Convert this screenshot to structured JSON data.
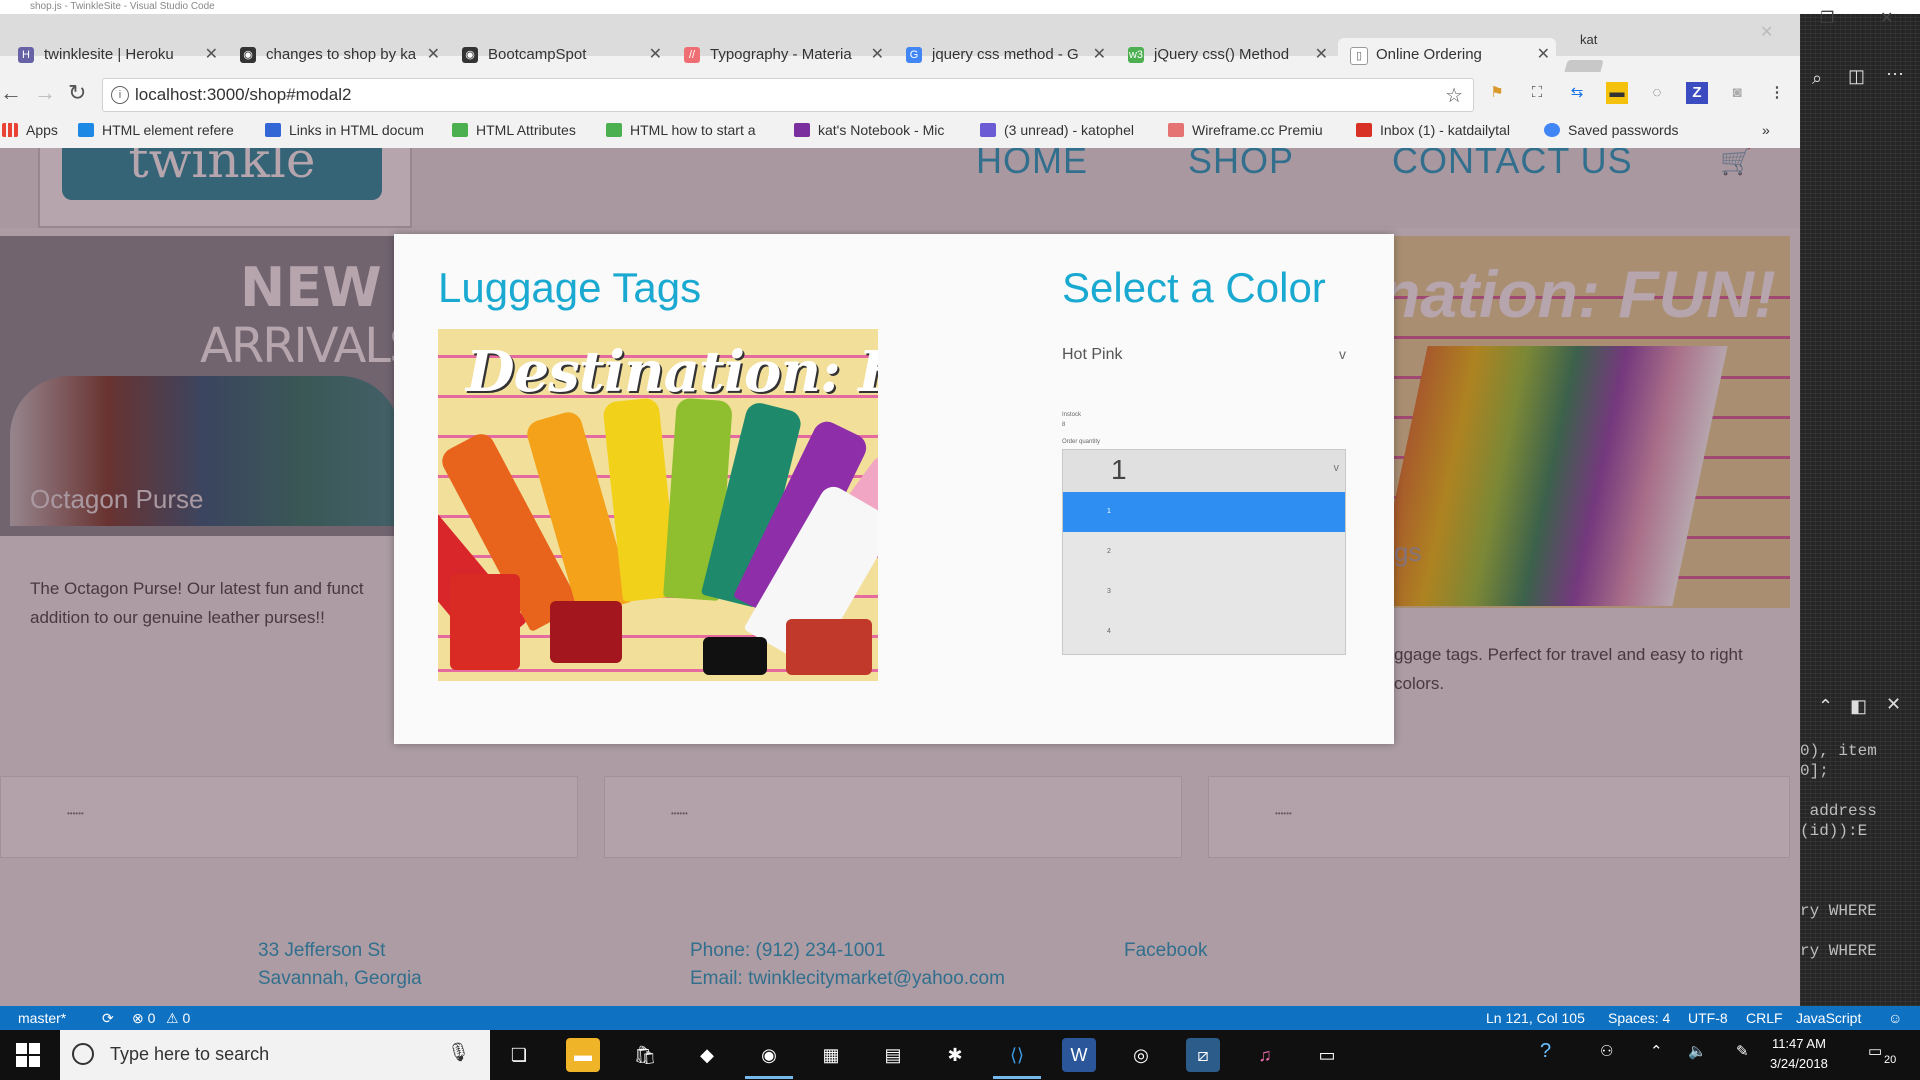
{
  "vscode": {
    "title": "shop.js - TwinkleSite - Visual Studio Code",
    "code_lines": [
      {
        "text": "0), item"
      },
      {
        "text": "0];"
      },
      {
        "text": " address"
      },
      {
        "text": "(id)):E"
      },
      {
        "text": "ry WHERE"
      },
      {
        "text": "ry WHERE"
      }
    ],
    "statusbar": {
      "branch": "master*",
      "sync": "⟳",
      "errors": "⊗ 0",
      "warnings": "⚠ 0",
      "position": "Ln 121, Col 105",
      "spaces": "Spaces: 4",
      "encoding": "UTF-8",
      "eol": "CRLF",
      "language": "JavaScript",
      "feedback": "☺"
    }
  },
  "browser": {
    "profile": "kat",
    "tabs": [
      {
        "label": "twinklesite | Heroku",
        "icon": "heroku-icon",
        "color": "#6762a6",
        "glyph": "H"
      },
      {
        "label": "changes to shop by ka",
        "icon": "github-icon",
        "color": "#333333",
        "glyph": "◉"
      },
      {
        "label": "BootcampSpot",
        "icon": "github-icon",
        "color": "#333333",
        "glyph": "◉"
      },
      {
        "label": "Typography - Materia",
        "icon": "materialize-icon",
        "color": "#ee6e73",
        "glyph": "//"
      },
      {
        "label": "jquery css method - G",
        "icon": "google-icon",
        "color": "#4285f4",
        "glyph": "G"
      },
      {
        "label": "jQuery css() Method",
        "icon": "w3schools-icon",
        "color": "#4caf50",
        "glyph": "w3"
      },
      {
        "label": "Online Ordering",
        "icon": "page-icon",
        "color": "#ffffff",
        "glyph": "▯"
      }
    ],
    "url": "localhost:3000/shop#modal2",
    "bookmarks": [
      {
        "label": "Apps",
        "color": "#e94335"
      },
      {
        "label": "HTML element refere",
        "color": "#1e88e5"
      },
      {
        "label": "Links in HTML docum",
        "color": "#3367d6"
      },
      {
        "label": "HTML Attributes",
        "color": "#4caf50"
      },
      {
        "label": "HTML how to start a",
        "color": "#4caf50"
      },
      {
        "label": "kat's Notebook - Mic",
        "color": "#7b2f9e"
      },
      {
        "label": "(3 unread) - katophel",
        "color": "#6b5cd6"
      },
      {
        "label": "Wireframe.cc Premiu",
        "color": "#e57373"
      },
      {
        "label": "Inbox (1) - katdailytal",
        "color": "#d93025"
      },
      {
        "label": "Saved passwords",
        "color": "#4285f4"
      }
    ],
    "bookmarks_more": "»"
  },
  "site": {
    "logo_text": "twinkle",
    "nav": [
      "HOME",
      "SHOP",
      "CONTACT US"
    ],
    "hero_left": {
      "new": "NEW",
      "arrivals": "ARRIVALS",
      "caption": "Octagon Purse"
    },
    "hero_right_text": "nation: FUN!",
    "card1_text": "The Octagon Purse! Our latest fun and funct addition to our genuine leather purses!!",
    "card3_text_peek": "gs",
    "card3_text": "ggage tags. Perfect for travel and easy to right colors.",
    "card_mini": "••••••",
    "footer": {
      "address1": "33 Jefferson St",
      "address2": "Savannah, Georgia",
      "phone": "Phone: (912) 234-1001",
      "email": "Email: twinklecitymarket@yahoo.com",
      "social": "Facebook"
    }
  },
  "modal": {
    "product_title": "Luggage Tags",
    "image_caption": "Destination: FUN!",
    "select_title": "Select a Color",
    "color_value": "Hot Pink",
    "color_chevron": "v",
    "tiny_label_1": "Instock",
    "tiny_label_1_value": "8",
    "tiny_label_2": "Order quantity",
    "quantity_value": "1",
    "quantity_options": [
      "1",
      "2",
      "3",
      "4"
    ],
    "selected_option_index": 0,
    "accent_color": "#1aa9d1",
    "selected_color": "#2f8ef1"
  },
  "taskbar": {
    "search_placeholder": "Type here to search",
    "time": "11:47 AM",
    "date": "3/24/2018",
    "notifications": "20"
  }
}
